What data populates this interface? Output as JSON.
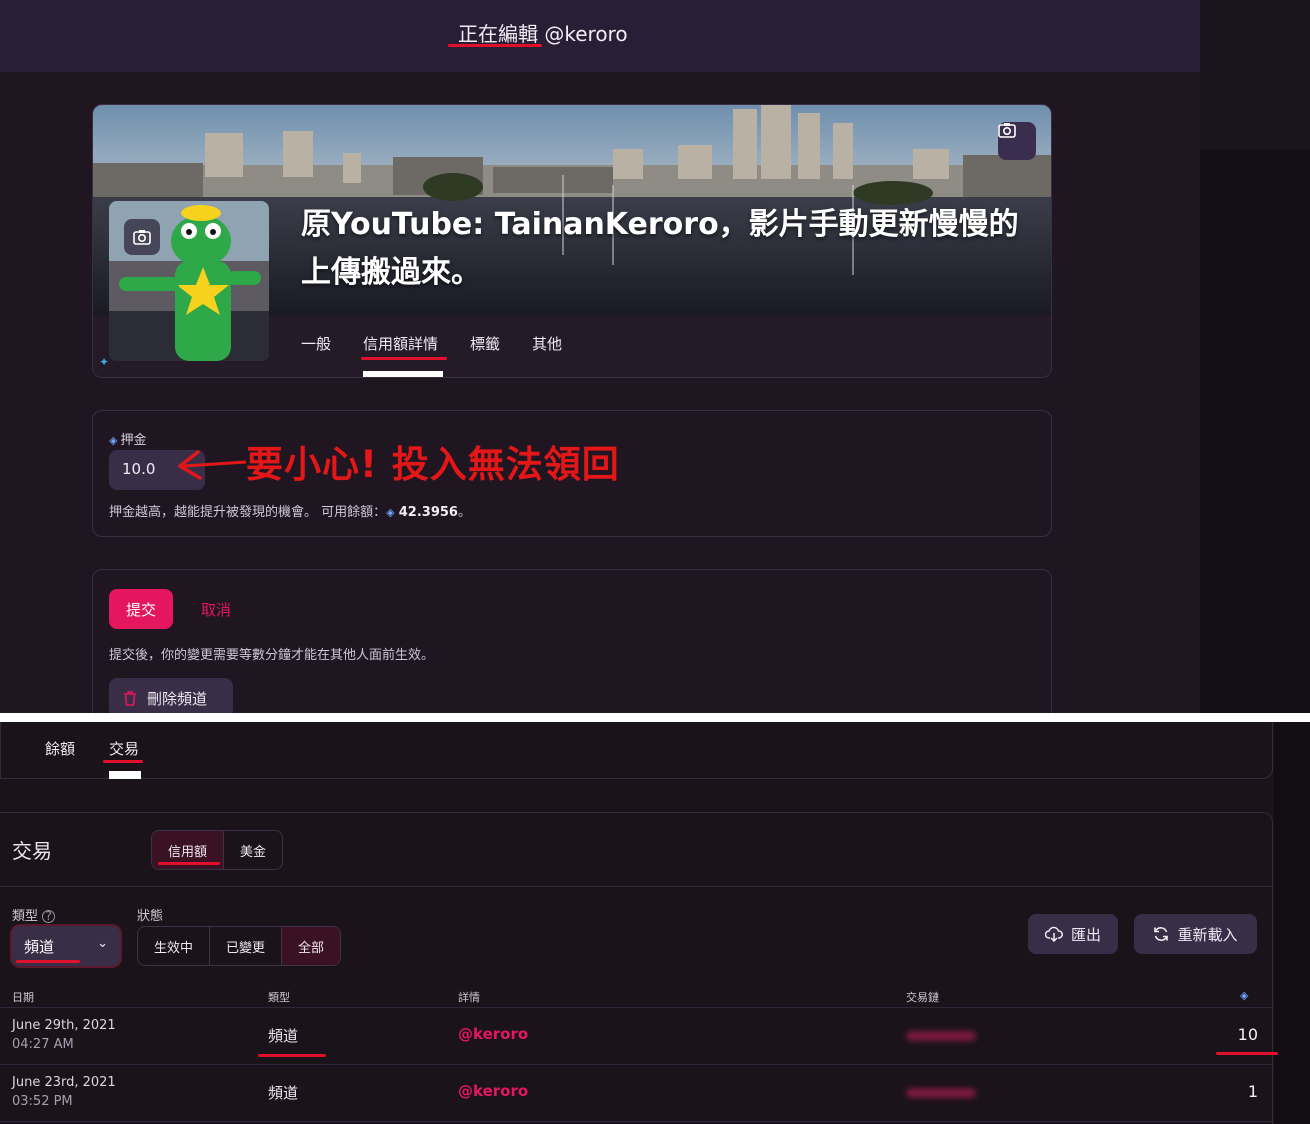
{
  "header": {
    "editing_prefix": "正在編輯",
    "handle": "@keroro"
  },
  "channel": {
    "title": "原YouTube: TainanKeroro，影片手動更新慢慢的上傳搬過來。",
    "tabs": [
      "一般",
      "信用額詳情",
      "標籤",
      "其他"
    ],
    "active_tab": "信用額詳情"
  },
  "deposit": {
    "label": "押金",
    "value": "10.0",
    "help_prefix": "押金越高，越能提升被發現的機會。 可用餘額：",
    "balance": "42.3956",
    "help_suffix": "。",
    "annotation": "要小心! 投入無法領回"
  },
  "actions": {
    "submit": "提交",
    "cancel": "取消",
    "note": "提交後，你的變更需要等數分鐘才能在其他人面前生效。",
    "delete": "刪除頻道"
  },
  "wallet_tabs": [
    "餘額",
    "交易"
  ],
  "transactions": {
    "heading": "交易",
    "currency_tabs": [
      "信用額",
      "美金"
    ],
    "type_label": "類型",
    "type_value": "頻道",
    "status_label": "狀態",
    "status_options": [
      "生效中",
      "已變更",
      "全部"
    ],
    "export": "匯出",
    "reload": "重新載入",
    "columns": [
      "日期",
      "類型",
      "詳情",
      "交易鏈"
    ],
    "rows": [
      {
        "date": "June 29th, 2021",
        "time": "04:27 AM",
        "type": "頻道",
        "detail": "@keroro",
        "amount": "10"
      },
      {
        "date": "June 23rd, 2021",
        "time": "03:52 PM",
        "type": "頻道",
        "detail": "@keroro",
        "amount": "1"
      }
    ]
  },
  "colors": {
    "accent": "#e4175e",
    "annotation_red": "#e0102b",
    "lbc": "#6fa8ff"
  }
}
